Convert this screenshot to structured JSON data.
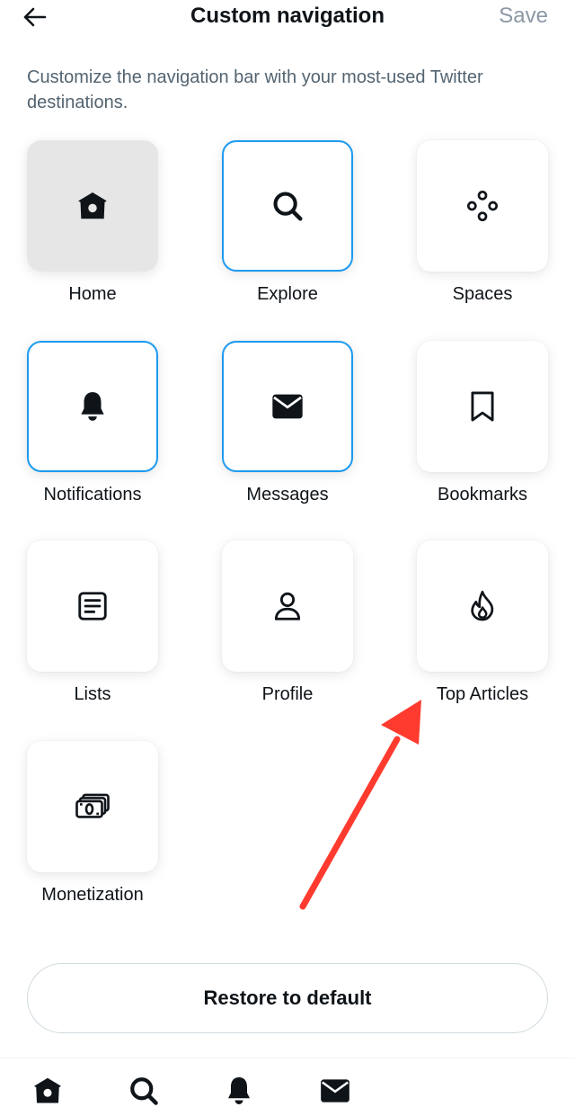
{
  "header": {
    "back_icon": "arrow-left-icon",
    "title": "Custom navigation",
    "save_label": "Save"
  },
  "description": "Customize the navigation bar with your most-used Twitter destinations.",
  "tiles": [
    {
      "label": "Home",
      "icon": "home-icon",
      "state": "current"
    },
    {
      "label": "Explore",
      "icon": "search-icon",
      "state": "selected"
    },
    {
      "label": "Spaces",
      "icon": "spaces-icon",
      "state": "unselected"
    },
    {
      "label": "Notifications",
      "icon": "bell-icon",
      "state": "selected"
    },
    {
      "label": "Messages",
      "icon": "envelope-icon",
      "state": "selected"
    },
    {
      "label": "Bookmarks",
      "icon": "bookmark-icon",
      "state": "unselected"
    },
    {
      "label": "Lists",
      "icon": "list-icon",
      "state": "unselected"
    },
    {
      "label": "Profile",
      "icon": "person-icon",
      "state": "unselected"
    },
    {
      "label": "Top Articles",
      "icon": "flame-icon",
      "state": "unselected"
    },
    {
      "label": "Monetization",
      "icon": "money-icon",
      "state": "unselected"
    }
  ],
  "restore_label": "Restore to default",
  "bottom_nav": [
    {
      "icon": "home-icon"
    },
    {
      "icon": "search-icon"
    },
    {
      "icon": "bell-icon"
    },
    {
      "icon": "envelope-icon"
    }
  ],
  "colors": {
    "accent_blue": "#1d9bf0",
    "text_primary": "#0f1419",
    "text_secondary": "#536471",
    "save_disabled": "#8b98a5",
    "annotation_arrow": "#ff3b2f"
  }
}
